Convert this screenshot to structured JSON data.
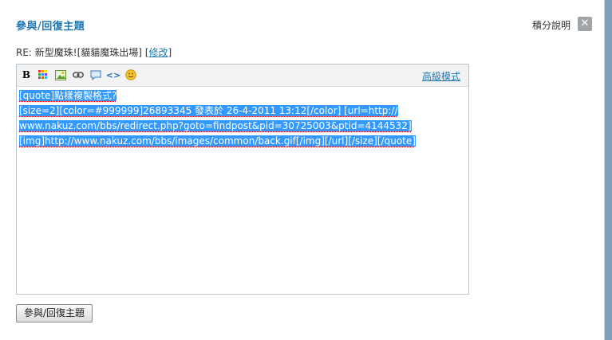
{
  "dialog": {
    "title": "參與/回復主題",
    "help_link": "積分說明",
    "close_icon_glyph": "✕"
  },
  "subject": {
    "prefix": "RE: 新型魔珠![貓貓魔珠出場] [",
    "edit_link": "修改",
    "suffix": "]"
  },
  "toolbar": {
    "icons": [
      "bold-icon",
      "color-icon",
      "image-icon",
      "link-icon",
      "quote-icon",
      "code-icon",
      "smiley-icon"
    ],
    "bold_glyph": "B",
    "advanced_mode": "高級模式"
  },
  "editor": {
    "lines": [
      "[quote]點樣複製格式?",
      "[size=2][color=#999999]26893345 發表於 26-4-2011 13:12[/color] [url=http://",
      "www.nakuz.com/bbs/redirect.php?goto=findpost&pid=30725003&ptid=4144532]",
      "[img]http://www.nakuz.com/bbs/images/common/back.gif[/img][/url][/size][/quote]"
    ]
  },
  "footer": {
    "submit_label": "參與/回復主題"
  }
}
